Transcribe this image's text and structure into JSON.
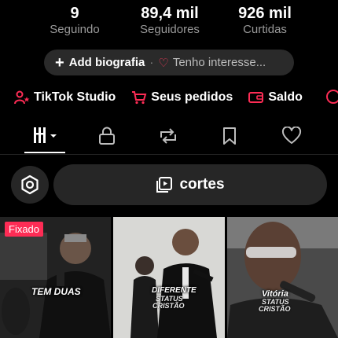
{
  "stats": [
    {
      "value": "9",
      "label": "Seguindo"
    },
    {
      "value": "89,4 mil",
      "label": "Seguidores"
    },
    {
      "value": "926 mil",
      "label": "Curtidas"
    }
  ],
  "bio": {
    "add_label": "Add biografia",
    "separator": "·",
    "interests_label": "Tenho interesse..."
  },
  "shortcuts": [
    {
      "label": "TikTok Studio",
      "icon": "person-star-icon"
    },
    {
      "label": "Seus pedidos",
      "icon": "cart-icon"
    },
    {
      "label": "Saldo",
      "icon": "wallet-icon"
    }
  ],
  "tabs": [
    {
      "icon": "grid-dropdown-icon",
      "active": true
    },
    {
      "icon": "lock-icon"
    },
    {
      "icon": "repost-icon"
    },
    {
      "icon": "bookmark-icon"
    },
    {
      "icon": "heart-icon"
    }
  ],
  "collection": {
    "label": "cortes"
  },
  "videos": [
    {
      "pinned_label": "Fixado",
      "overlay": "TEM DUAS"
    },
    {
      "overlay": "DIFERENTE",
      "sub1": "STATUS",
      "sub2": "CRISTÃO"
    },
    {
      "overlay": "Vitória",
      "sub1": "STATUS",
      "sub2": "CRISTÃO"
    }
  ],
  "colors": {
    "accent": "#fe2c55",
    "background": "#000000",
    "pill": "#2a2a2a"
  }
}
